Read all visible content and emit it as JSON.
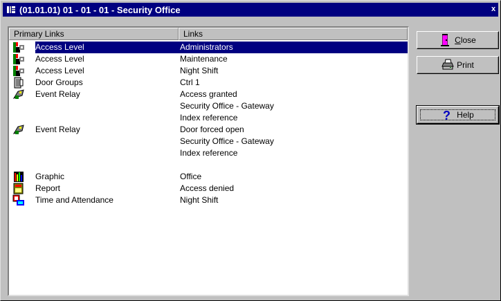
{
  "window": {
    "title": "(01.01.01) 01 - 01 - 01 - Security Office",
    "close_glyph": "x"
  },
  "list": {
    "columns": {
      "primary": "Primary Links",
      "links": "Links"
    },
    "rows": [
      {
        "icon": "access-level-icon",
        "primary": "Access Level",
        "link": "Administrators",
        "selected": true
      },
      {
        "icon": "access-level-icon",
        "primary": "Access Level",
        "link": "Maintenance"
      },
      {
        "icon": "access-level-icon",
        "primary": "Access Level",
        "link": "Night Shift"
      },
      {
        "icon": "door-groups-icon",
        "primary": "Door Groups",
        "link": "Ctrl 1"
      },
      {
        "icon": "event-relay-icon",
        "primary": "Event Relay",
        "link": "Access granted"
      },
      {
        "icon": "",
        "primary": "",
        "link": "Security Office - Gateway"
      },
      {
        "icon": "",
        "primary": "",
        "link": "Index reference"
      },
      {
        "icon": "event-relay-icon",
        "primary": "Event Relay",
        "link": "Door forced open"
      },
      {
        "icon": "",
        "primary": "",
        "link": "Security Office - Gateway"
      },
      {
        "icon": "",
        "primary": "",
        "link": "Index reference"
      },
      {
        "icon": "",
        "primary": "",
        "link": ""
      },
      {
        "icon": "graphic-icon",
        "primary": "Graphic",
        "link": "Office"
      },
      {
        "icon": "report-icon",
        "primary": "Report",
        "link": "Access denied"
      },
      {
        "icon": "time-attendance-icon",
        "primary": "Time and Attendance",
        "link": "Night Shift"
      }
    ]
  },
  "buttons": {
    "close": {
      "label": "Close",
      "mnemonic": "C",
      "rest": "lose",
      "icon": "door-icon"
    },
    "print": {
      "label": "Print",
      "icon": "printer-icon"
    },
    "help": {
      "label": "Help",
      "icon": "question-mark-icon"
    }
  },
  "colors": {
    "titlebar": "#000080",
    "selection": "#000080",
    "face": "#c0c0c0"
  }
}
